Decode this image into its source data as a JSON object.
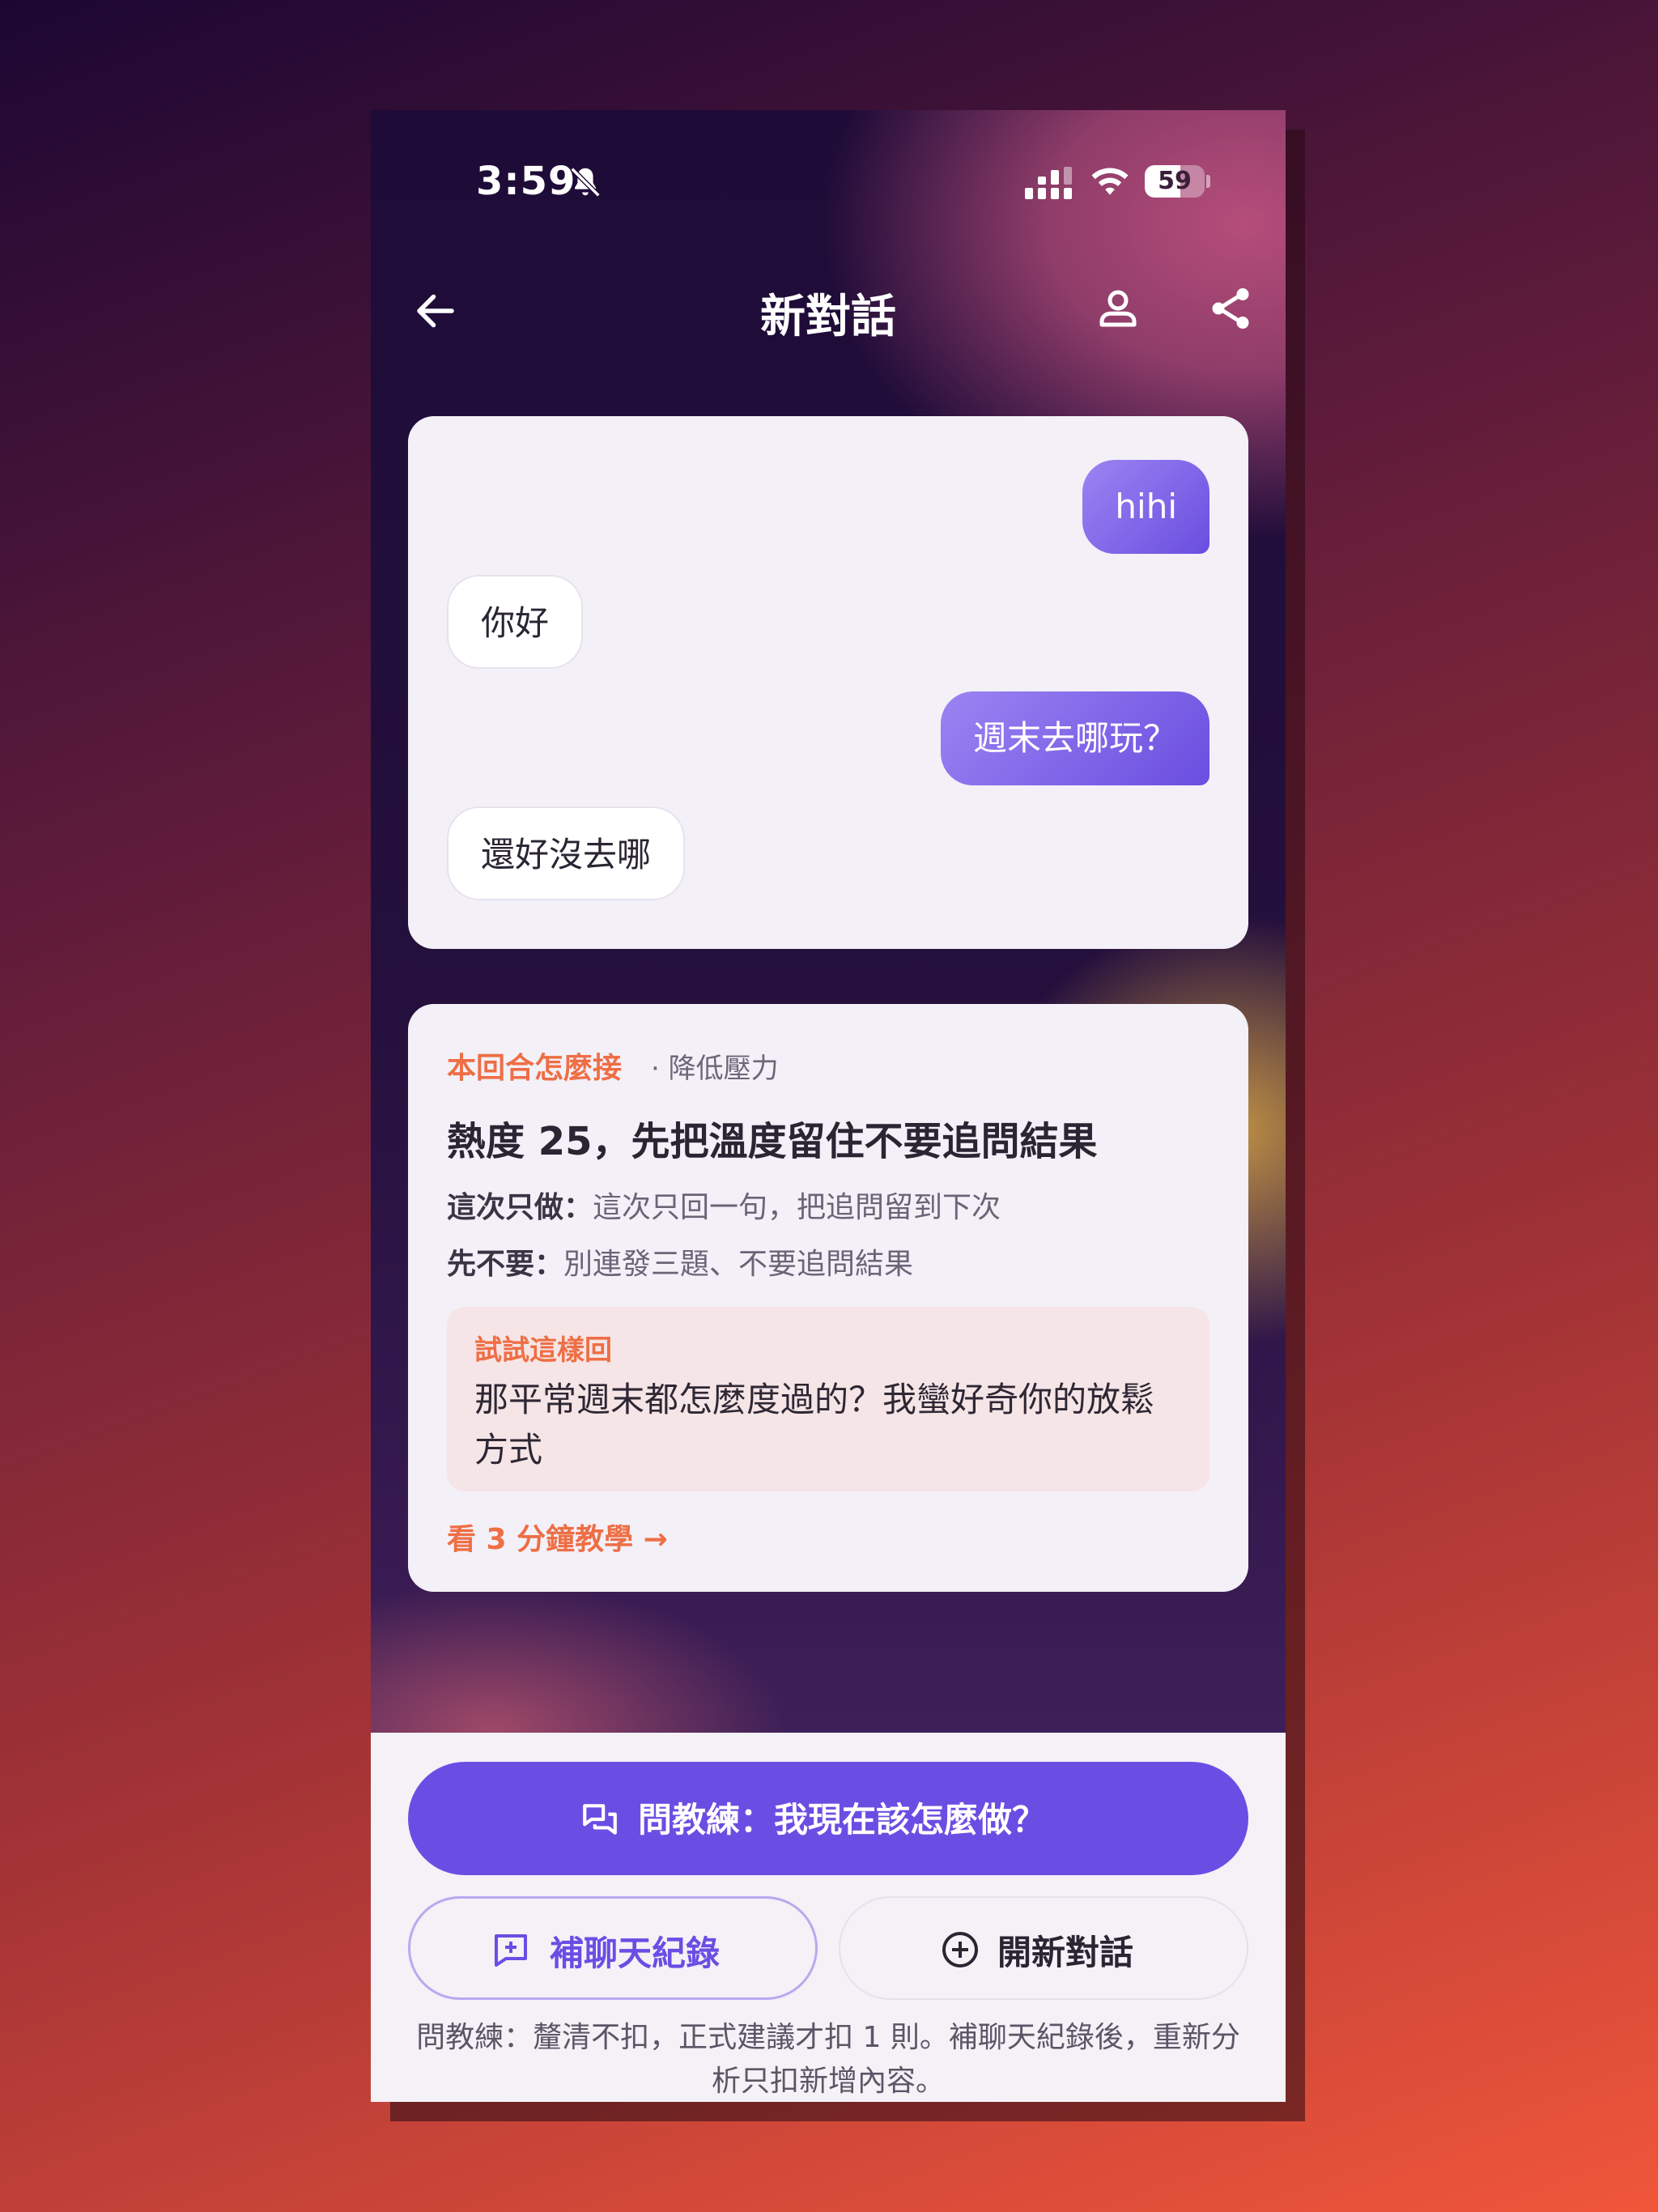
{
  "status_bar": {
    "time": "3:59",
    "battery": "59",
    "battery_level": 0.59
  },
  "header": {
    "title": "新對話"
  },
  "chat": {
    "messages": [
      {
        "sender": "me",
        "text": "hihi"
      },
      {
        "sender": "other",
        "text": "你好"
      },
      {
        "sender": "me",
        "text": "週末去哪玩？"
      },
      {
        "sender": "other",
        "text": "還好沒去哪"
      }
    ]
  },
  "advice": {
    "tag": "本回合怎麼接",
    "subtitle": "· 降低壓力",
    "headline": "熱度 25，先把溫度留住不要追問結果",
    "do_label": "這次只做：",
    "do_text": "這次只回一句，把追問留到下次",
    "dont_label": "先不要：",
    "dont_text": "別連發三題、不要追問結果",
    "try_label": "試試這樣回",
    "try_text": "那平常週末都怎麼度過的？我蠻好奇你的放鬆方式",
    "tutorial_link": "看 3 分鐘教學 →"
  },
  "actions": {
    "ask_coach": "問教練：我現在該怎麼做？",
    "add_chat": "補聊天紀錄",
    "new_chat": "開新對話",
    "note": "問教練：釐清不扣，正式建議才扣 1 則。補聊天紀錄後，重新分析只扣新增內容。"
  },
  "colors": {
    "accent": "#6a4ee3",
    "highlight": "#ee6e45",
    "tryit_bg": "#f6e5e6"
  }
}
